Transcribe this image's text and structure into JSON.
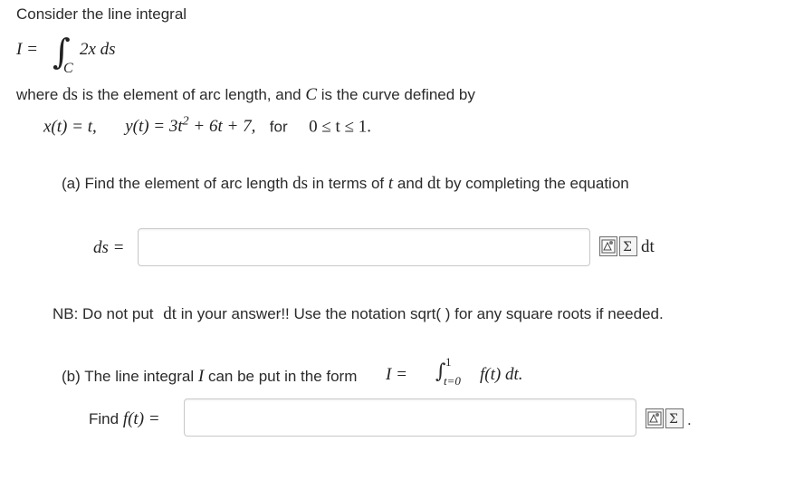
{
  "intro": "Consider the line integral",
  "integral": {
    "lhs": "I =",
    "symbol": "∫",
    "sub": "C",
    "integrand": "2x ds"
  },
  "where_text": {
    "part1": "where",
    "ds": "ds",
    "part2": "is the element of arc length, and",
    "C": "C",
    "part3": "is the curve defined by"
  },
  "curve": {
    "x_eq": "x(t) = t,",
    "y_eq_pre": "y(t) = 3t",
    "y_exp": "2",
    "y_eq_post": " + 6t + 7,",
    "for": "for",
    "range": "0 ≤ t ≤ 1."
  },
  "part_a": {
    "text1": "(a)  Find the element of arc length",
    "ds": "ds",
    "text2": "in terms of",
    "t": "t",
    "text3": "and",
    "dt": "dt",
    "text4": "by completing the equation",
    "label": "ds =",
    "input_value": "",
    "after_label": "dt"
  },
  "nb": {
    "text1": "NB: Do not put",
    "dt": "dt",
    "text2": "in your answer!! Use the notation sqrt( ) for any square roots if needed."
  },
  "part_b": {
    "text1": "(b)  The line integral",
    "I": "I",
    "text2": "can be put in the form",
    "form_pre": "I =",
    "int": "∫",
    "upper": "1",
    "lower": "t=0",
    "form_post": "f(t) dt.",
    "find": "Find",
    "label": "f(t) =",
    "input_value": "",
    "trailing": "."
  },
  "icons": [
    "preview-icon",
    "equation-editor-icon"
  ],
  "colors": {
    "input_border": "#c9c9c9",
    "icon_border": "#6f6f6f"
  }
}
